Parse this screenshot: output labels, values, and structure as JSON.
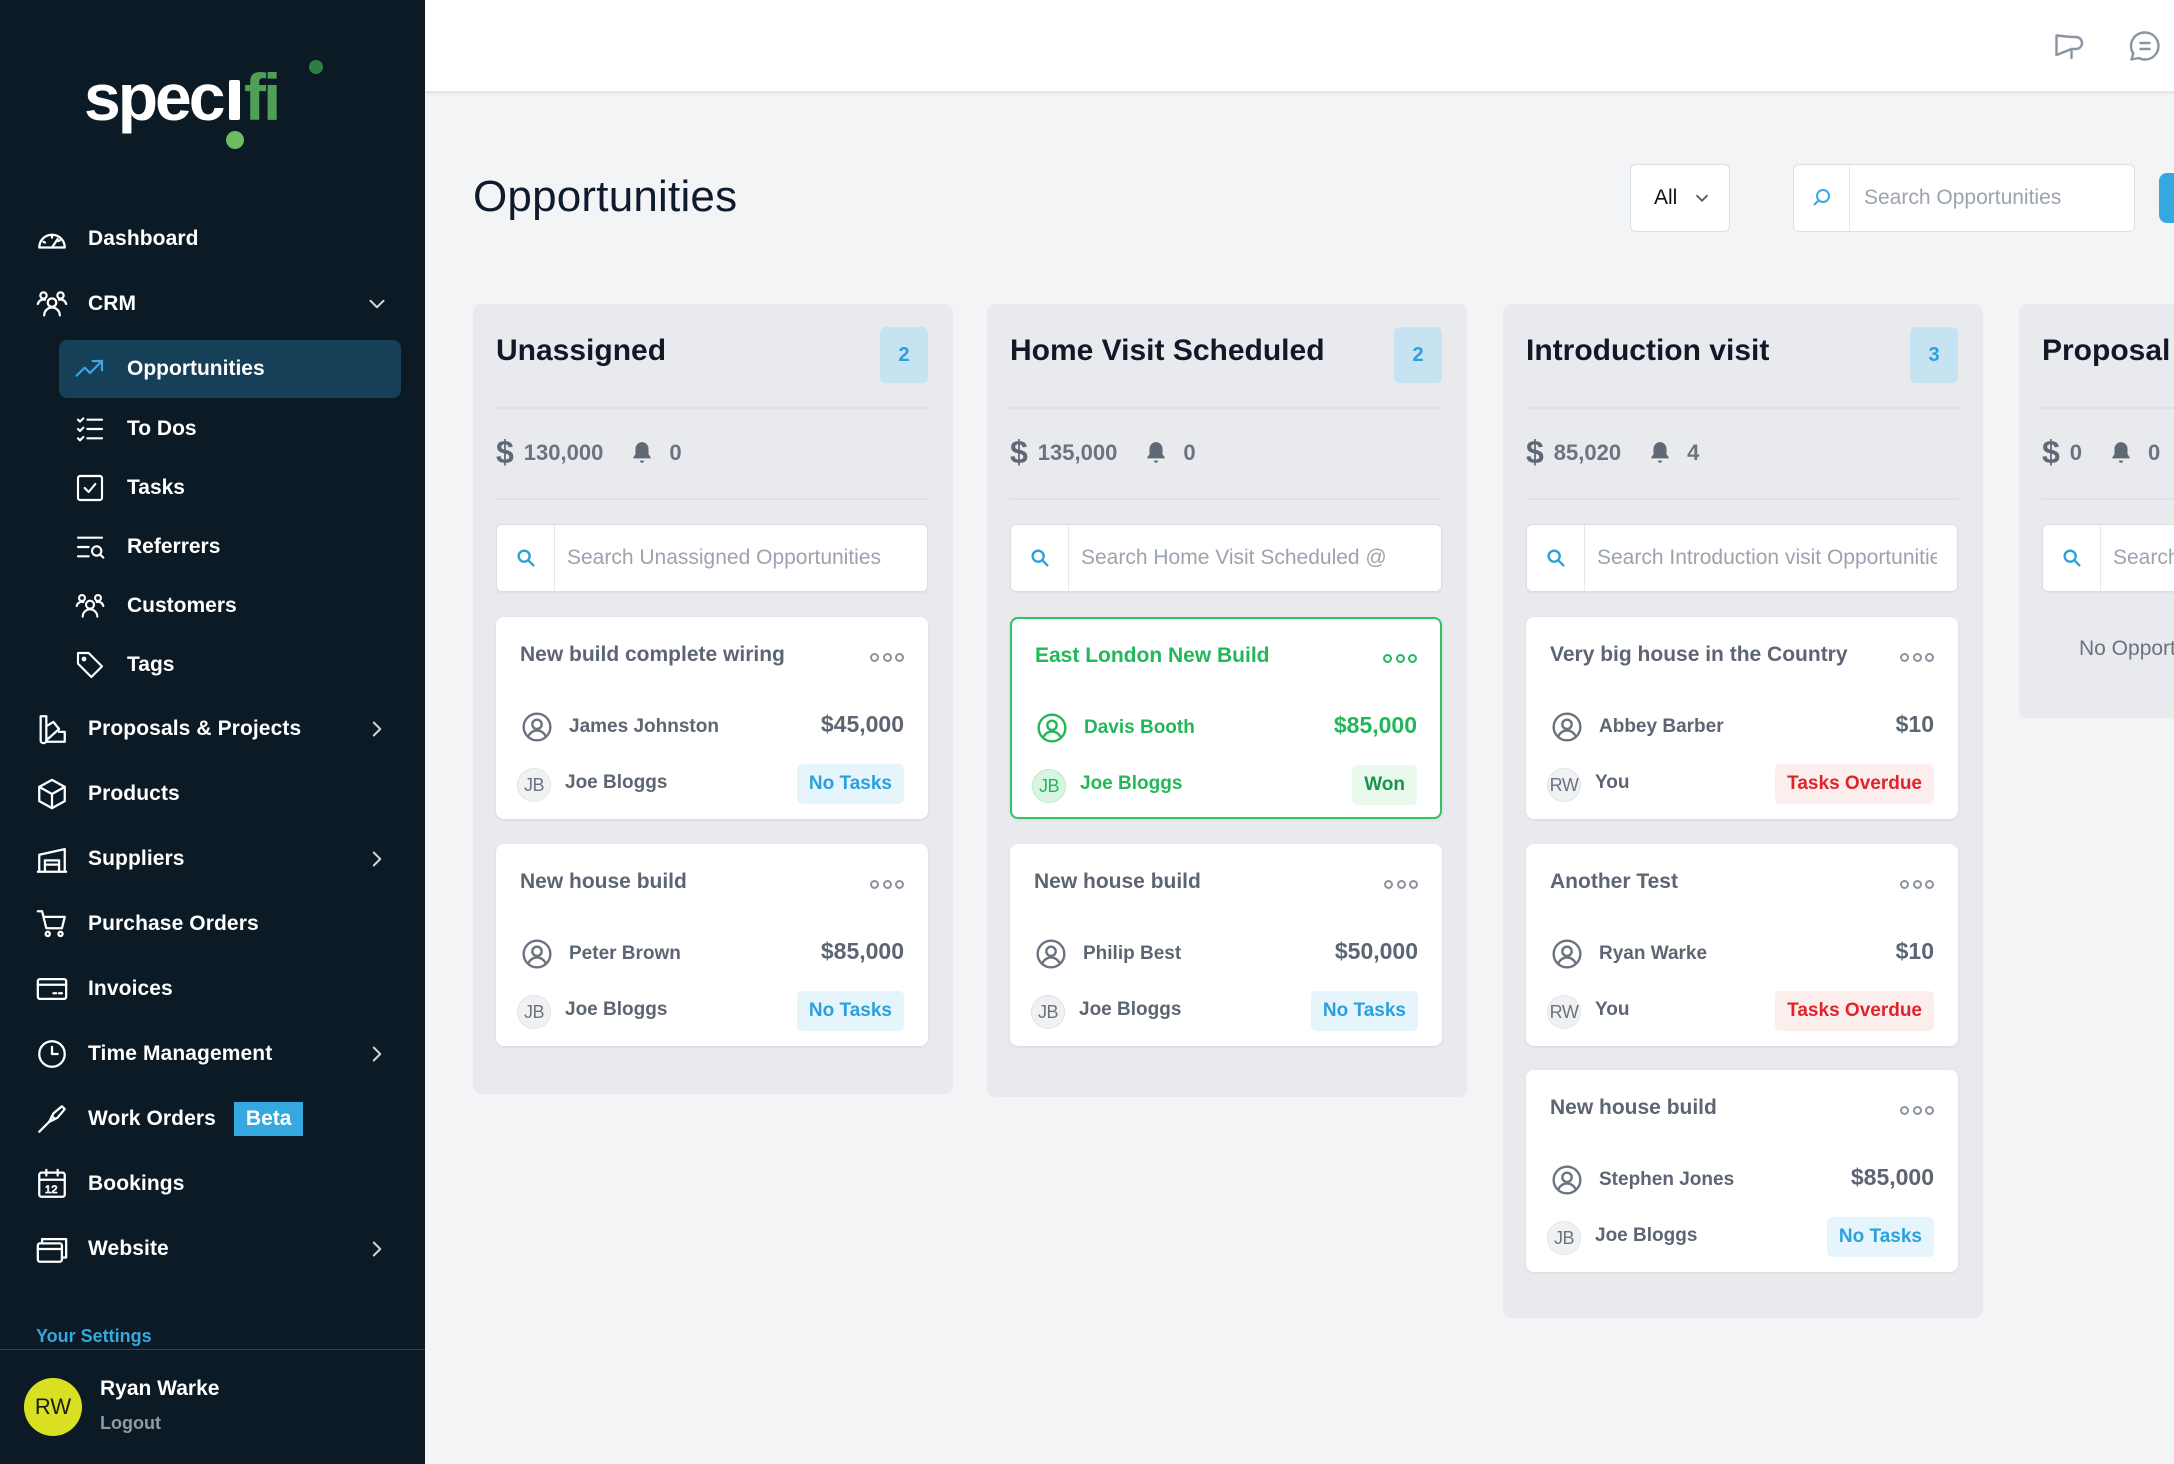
{
  "app": {
    "brand": "specifi",
    "brand_colors": {
      "white": "#ffffff",
      "green": "#4caf50",
      "accent": "#35a8e0"
    }
  },
  "sidebar": {
    "items": [
      {
        "label": "Dashboard",
        "icon": "dashboard-icon"
      },
      {
        "label": "CRM",
        "icon": "users-group-icon",
        "expanded": true
      },
      {
        "label": "Proposals & Projects",
        "icon": "swatch-icon",
        "has_submenu": true
      },
      {
        "label": "Products",
        "icon": "cube-icon"
      },
      {
        "label": "Suppliers",
        "icon": "warehouse-icon",
        "has_submenu": true
      },
      {
        "label": "Purchase Orders",
        "icon": "cart-icon"
      },
      {
        "label": "Invoices",
        "icon": "credit-card-icon"
      },
      {
        "label": "Time Management",
        "icon": "clock-icon",
        "has_submenu": true
      },
      {
        "label": "Work Orders",
        "icon": "screwdriver-icon",
        "badge": "Beta"
      },
      {
        "label": "Bookings",
        "icon": "calendar-icon"
      },
      {
        "label": "Website",
        "icon": "browser-windows-icon",
        "has_submenu": true
      }
    ],
    "crm_subitems": [
      {
        "label": "Opportunities",
        "icon": "trending-up-icon",
        "active": true
      },
      {
        "label": "To Dos",
        "icon": "checklist-icon"
      },
      {
        "label": "Tasks",
        "icon": "checkbox-icon"
      },
      {
        "label": "Referrers",
        "icon": "list-search-icon"
      },
      {
        "label": "Customers",
        "icon": "users-group-icon"
      },
      {
        "label": "Tags",
        "icon": "tag-icon"
      }
    ],
    "settings_label": "Your Settings",
    "user": {
      "initials": "RW",
      "name": "Ryan Warke",
      "logout_label": "Logout"
    }
  },
  "header": {
    "icons": [
      "megaphone-icon",
      "chat-icon"
    ]
  },
  "page": {
    "title": "Opportunities",
    "filter": {
      "selected": "All"
    },
    "search": {
      "placeholder": "Search Opportunities",
      "value": ""
    }
  },
  "columns": [
    {
      "title": "Unassigned",
      "count": "2",
      "total": "130,000",
      "alerts": "0",
      "search_placeholder": "Search Unassigned Opportunities",
      "cards": [
        {
          "title": "New build complete wiring",
          "customer": "James Johnston",
          "value": "$45,000",
          "owner_initials": "JB",
          "owner": "Joe Bloggs",
          "status": "No Tasks",
          "status_type": "none"
        },
        {
          "title": "New house build",
          "customer": "Peter Brown",
          "value": "$85,000",
          "owner_initials": "JB",
          "owner": "Joe Bloggs",
          "status": "No Tasks",
          "status_type": "none"
        }
      ]
    },
    {
      "title": "Home Visit Scheduled",
      "count": "2",
      "total": "135,000",
      "alerts": "0",
      "search_placeholder": "Search Home Visit Scheduled @",
      "cards": [
        {
          "title": "East London New Build",
          "customer": "Davis Booth",
          "value": "$85,000",
          "owner_initials": "JB",
          "owner": "Joe Bloggs",
          "status": "Won",
          "status_type": "won"
        },
        {
          "title": "New house build",
          "customer": "Philip Best",
          "value": "$50,000",
          "owner_initials": "JB",
          "owner": "Joe Bloggs",
          "status": "No Tasks",
          "status_type": "none"
        }
      ]
    },
    {
      "title": "Introduction visit",
      "count": "3",
      "total": "85,020",
      "alerts": "4",
      "search_placeholder": "Search Introduction visit Opportunities",
      "cards": [
        {
          "title": "Very big house in the Country",
          "customer": "Abbey Barber",
          "value": "$10",
          "owner_initials": "RW",
          "owner": "You",
          "status": "Tasks Overdue",
          "status_type": "overdue"
        },
        {
          "title": "Another Test",
          "customer": "Ryan Warke",
          "value": "$10",
          "owner_initials": "RW",
          "owner": "You",
          "status": "Tasks Overdue",
          "status_type": "overdue"
        },
        {
          "title": "New house build",
          "customer": "Stephen Jones",
          "value": "$85,000",
          "owner_initials": "JB",
          "owner": "Joe Bloggs",
          "status": "No Tasks",
          "status_type": "none"
        }
      ]
    },
    {
      "title": "Proposal",
      "count": "",
      "total": "0",
      "alerts": "0",
      "search_placeholder": "Search",
      "empty_text": "No Opportunities",
      "cards": []
    }
  ]
}
